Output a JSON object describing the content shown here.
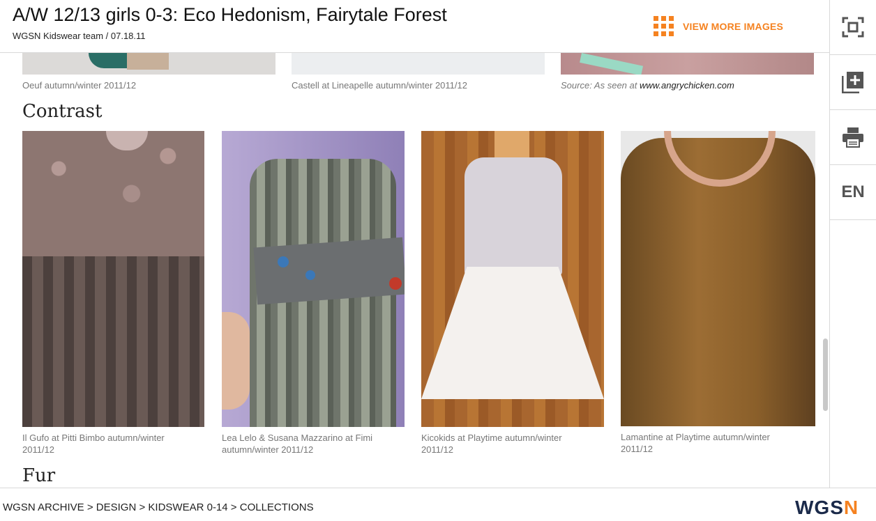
{
  "header": {
    "title": "A/W 12/13 girls 0-3: Eco Hedonism, Fairytale Forest",
    "byline": "WGSN Kidswear team / 07.18.11",
    "view_more_label": "VIEW MORE IMAGES",
    "view_more_icon": "grid-icon"
  },
  "sidebar": {
    "buttons": [
      {
        "icon": "fullscreen-icon"
      },
      {
        "icon": "add-to-board-icon"
      },
      {
        "icon": "print-icon"
      },
      {
        "label": "EN"
      }
    ]
  },
  "previous_row": {
    "captions": [
      "Oeuf autumn/winter 2011/12",
      "Castell at Lineapelle autumn/winter 2011/12"
    ],
    "source_prefix": "Source: As seen at ",
    "source_link": "www.angrychicken.com"
  },
  "sections": [
    {
      "heading": "Contrast",
      "items": [
        {
          "caption_line1": "Il Gufo at Pitti Bimbo autumn/winter",
          "caption_line2": "2011/12"
        },
        {
          "caption_line1": "Lea Lelo & Susana Mazzarino at Fimi",
          "caption_line2": "autumn/winter 2011/12"
        },
        {
          "caption_line1": "Kicokids at Playtime autumn/winter",
          "caption_line2": "2011/12"
        },
        {
          "caption_line1": "Lamantine at Playtime autumn/winter",
          "caption_line2": "2011/12"
        }
      ]
    },
    {
      "heading": "Fur"
    }
  ],
  "footer": {
    "breadcrumb": [
      "WGSN ARCHIVE",
      "DESIGN",
      "KIDSWEAR 0-14",
      "COLLECTIONS"
    ],
    "separator": " > ",
    "logo_prefix": "WGS",
    "logo_suffix": "N"
  },
  "colors": {
    "accent": "#f58220",
    "logo_navy": "#1b2a4a",
    "caption_gray": "#777777"
  }
}
